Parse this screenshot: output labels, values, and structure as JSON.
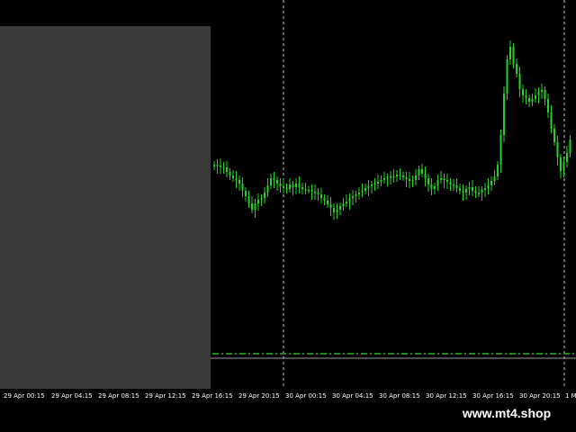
{
  "colors": {
    "background": "#000000",
    "candle": "#22d422",
    "panel": "#3a3a3a",
    "grid": "#c8c8c8",
    "level_line": "#1e8a1e"
  },
  "time_axis": {
    "labels": [
      "29 Apr 00:15",
      "29 Apr 04:15",
      "29 Apr 08:15",
      "29 Apr 12:15",
      "29 Apr 16:15",
      "29 Apr 20:15",
      "30 Apr 00:15",
      "30 Apr 04:15",
      "30 Apr 08:15",
      "30 Apr 12:15",
      "30 Apr 16:15",
      "30 Apr 20:15",
      "1 M"
    ]
  },
  "watermark": {
    "text": "www.mt4.shop"
  },
  "chart_data": {
    "type": "candlestick",
    "series": [
      {
        "values": [
          183,
          184,
          185,
          186,
          191,
          195,
          198,
          200,
          204,
          212,
          218,
          226,
          233,
          226,
          222,
          220,
          214,
          206,
          198,
          200,
          204,
          207,
          209,
          210,
          205,
          208,
          204,
          208,
          210,
          211,
          211,
          213,
          214,
          216,
          220,
          223,
          227,
          231,
          236,
          233,
          229,
          226,
          224,
          220,
          218,
          216,
          214,
          212,
          209,
          207,
          205,
          204,
          202,
          200,
          198,
          197,
          196,
          196,
          194,
          195,
          197,
          199,
          201,
          200,
          195,
          188,
          193,
          198,
          205,
          210,
          207,
          200,
          198,
          200,
          202,
          205,
          206,
          209,
          212,
          214,
          210,
          208,
          212,
          215,
          214,
          211,
          209,
          206,
          201,
          196,
          183,
          150,
          104,
          66,
          52,
          71,
          82,
          99,
          106,
          109,
          113,
          110,
          106,
          102,
          100,
          110,
          125,
          143,
          158,
          175,
          190,
          180,
          170,
          155
        ]
      }
    ]
  }
}
